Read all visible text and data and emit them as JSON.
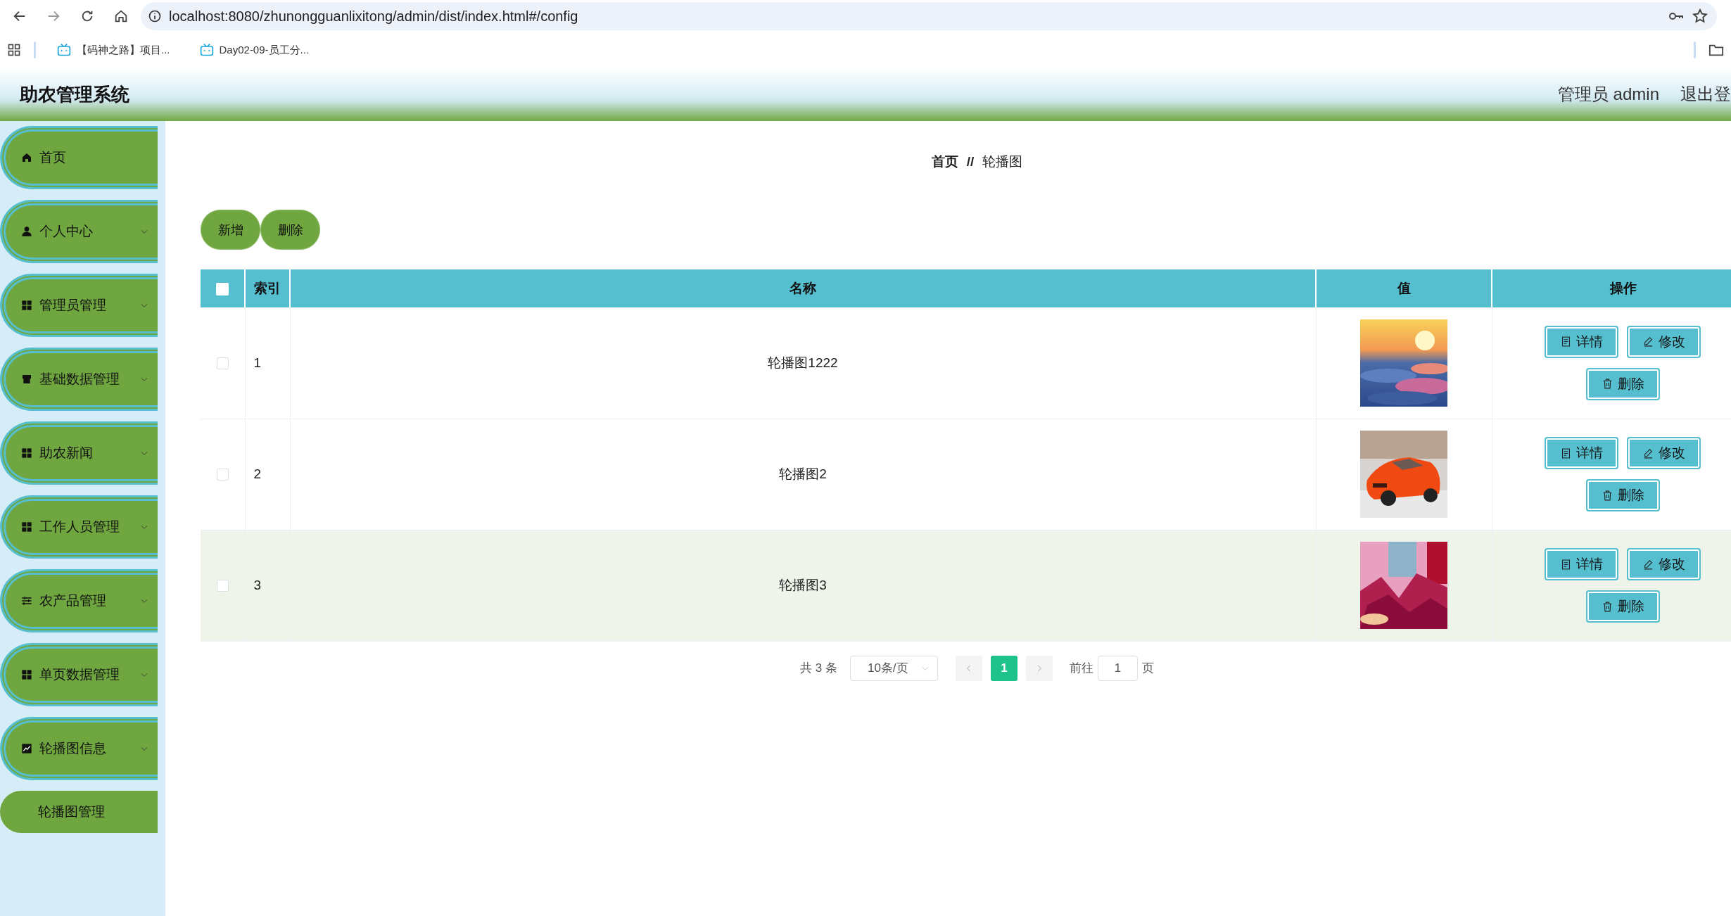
{
  "browser": {
    "url": "localhost:8080/zhunongguanlixitong/admin/dist/index.html#/config",
    "bookmarks": [
      "【码神之路】项目...",
      "Day02-09-员工分..."
    ]
  },
  "header": {
    "title": "助农管理系统",
    "user": "管理员 admin",
    "logout": "退出登"
  },
  "sidebar": {
    "items": [
      {
        "label": "首页",
        "kind": "link"
      },
      {
        "label": "个人中心",
        "kind": "submenu"
      },
      {
        "label": "管理员管理",
        "kind": "submenu"
      },
      {
        "label": "基础数据管理",
        "kind": "submenu"
      },
      {
        "label": "助农新闻",
        "kind": "submenu"
      },
      {
        "label": "工作人员管理",
        "kind": "submenu"
      },
      {
        "label": "农产品管理",
        "kind": "submenu"
      },
      {
        "label": "单页数据管理",
        "kind": "submenu"
      },
      {
        "label": "轮播图信息",
        "kind": "submenu",
        "children": [
          {
            "label": "轮播图管理"
          }
        ]
      }
    ]
  },
  "breadcrumb": {
    "home": "首页",
    "separator": "//",
    "current": "轮播图"
  },
  "toolbar": [
    "新增",
    "删除"
  ],
  "table": {
    "columns": [
      "索引",
      "名称",
      "值",
      "操作"
    ],
    "all_checked": false,
    "rows": [
      {
        "checked": false,
        "hovered": false,
        "index": "1",
        "name": "轮播图1222",
        "value": {
          "kind": "picture"
        },
        "actions": [
          "详情",
          "修改",
          "删除"
        ]
      },
      {
        "checked": false,
        "hovered": false,
        "index": "2",
        "name": "轮播图2",
        "value": {
          "kind": "picture"
        },
        "actions": [
          "详情",
          "修改",
          "删除"
        ]
      },
      {
        "checked": false,
        "hovered": true,
        "index": "3",
        "name": "轮播图3",
        "value": {
          "kind": "picture"
        },
        "actions": [
          "详情",
          "修改",
          "删除"
        ]
      }
    ]
  },
  "pagination": {
    "total": "共 3 条",
    "page_size": "10条/页",
    "pages": [
      {
        "label": "1",
        "selected": true
      }
    ],
    "goto_label": "前往",
    "goto_value": "1",
    "goto_suffix": "页"
  }
}
